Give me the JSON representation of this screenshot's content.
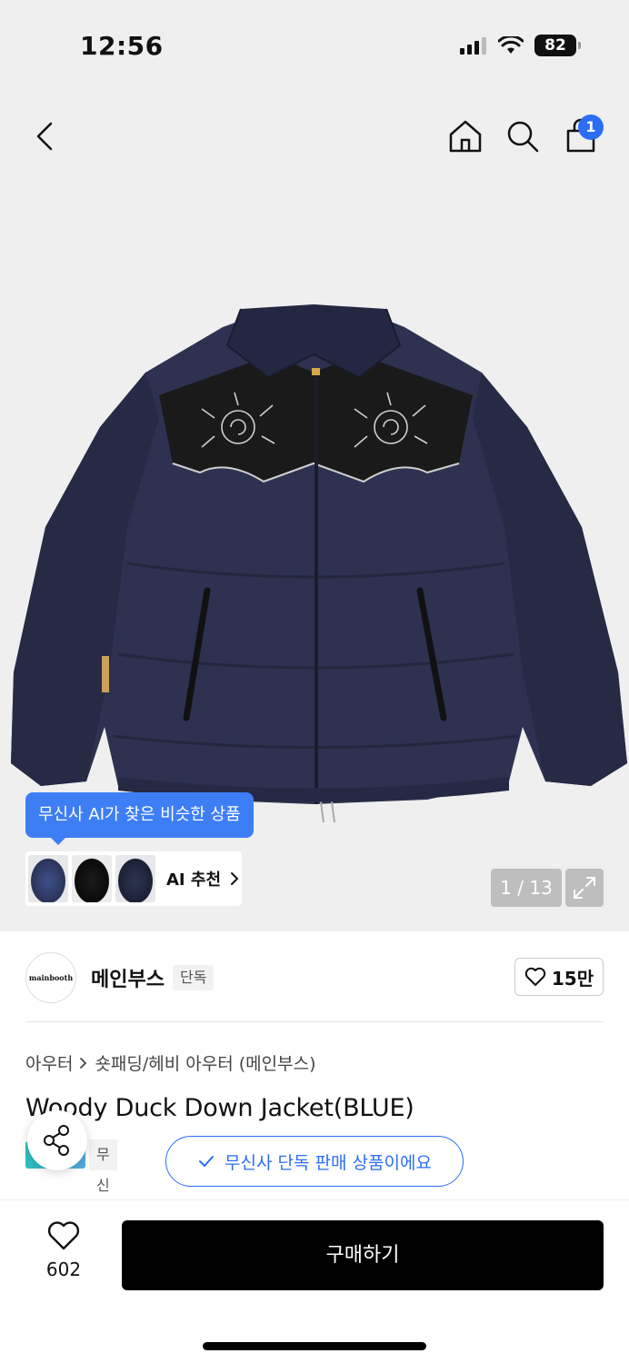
{
  "status_bar": {
    "time": "12:56",
    "battery": "82"
  },
  "header": {
    "cart_count": "1"
  },
  "product_image": {
    "alt": "Woody Duck Down Jacket(BLUE)",
    "colors": {
      "jacket": "#2e3250",
      "yoke": "#1a1a1a",
      "stitch": "#cfcfcf"
    }
  },
  "ai_recommend": {
    "tooltip": "무신사 AI가 찾은 비슷한 상품",
    "label": "AI 추천"
  },
  "gallery": {
    "counter": "1 / 13"
  },
  "brand": {
    "logo_text": "mainbooth",
    "name": "메인부스",
    "tag": "단독",
    "likes": "15만"
  },
  "breadcrumb": {
    "category": "아우터",
    "subcategory": "숏패딩/헤비 아우터 (메인부스)"
  },
  "product": {
    "title": "Woody Duck Down Jacket(BLUE)"
  },
  "exclusive": {
    "chip_text": "무신사단독",
    "tooltip": "무신사 단독 판매 상품이에요"
  },
  "bottom_bar": {
    "wish_count": "602",
    "buy_label": "구매하기"
  },
  "colors": {
    "accent": "#2b6ef5",
    "tooltip_blue": "#3d7ef5",
    "hero_bg": "#efefef"
  }
}
